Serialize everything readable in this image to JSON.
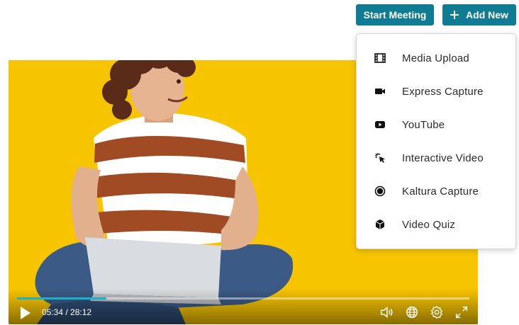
{
  "header": {
    "start_meeting_label": "Start Meeting",
    "add_new_label": "Add New"
  },
  "add_new_menu": {
    "items": [
      {
        "label": "Media Upload",
        "icon": "film-icon"
      },
      {
        "label": "Express Capture",
        "icon": "video-camera-icon"
      },
      {
        "label": "YouTube",
        "icon": "youtube-icon"
      },
      {
        "label": "Interactive Video",
        "icon": "cursor-click-icon"
      },
      {
        "label": "Kaltura Capture",
        "icon": "record-circle-icon"
      },
      {
        "label": "Video Quiz",
        "icon": "cube-icon"
      }
    ]
  },
  "player": {
    "time_display": "05:34 / 28:12",
    "progress_fraction": 0.198,
    "controls": [
      "play-icon",
      "volume-icon",
      "language-icon",
      "settings-icon",
      "fullscreen-icon"
    ]
  },
  "colors": {
    "accent": "#0f7c93",
    "video_background": "#f6c400",
    "progress": "#17b3c8"
  }
}
